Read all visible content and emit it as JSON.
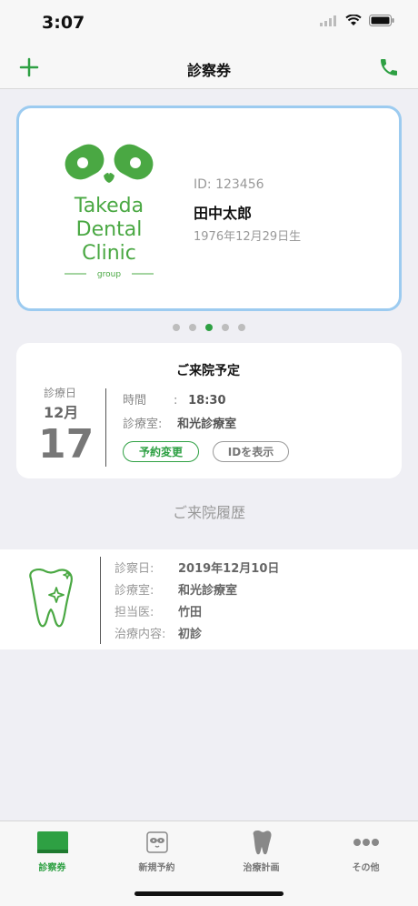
{
  "status_bar": {
    "time": "3:07"
  },
  "nav": {
    "title": "診察券"
  },
  "card": {
    "logo": {
      "line1": "Takeda",
      "line2": "Dental",
      "line3": "Clinic",
      "line4": "group"
    },
    "id": "ID: 123456",
    "name": "田中太郎",
    "dob": "1976年12月29日生"
  },
  "pager": {
    "count": 5,
    "active_index": 2
  },
  "appointment": {
    "title": "ご来院予定",
    "date_label": "診療日",
    "month": "12月",
    "day": "17",
    "time_label": "時間",
    "time_sep": ":",
    "time_value": "18:30",
    "room_label": "診療室:",
    "room_value": "和光診療室",
    "change_button": "予約変更",
    "show_id_button": "IDを表示"
  },
  "history": {
    "title": "ご来院履歴",
    "items": [
      {
        "date_label": "診察日:",
        "date_value": "2019年12月10日",
        "room_label": "診療室:",
        "room_value": "和光診療室",
        "doctor_label": "担当医:",
        "doctor_value": "竹田",
        "treatment_label": "治療内容:",
        "treatment_value": "初診"
      }
    ]
  },
  "tabs": [
    {
      "label": "診察券",
      "icon": "card-icon",
      "active": true
    },
    {
      "label": "新規予約",
      "icon": "panda-icon",
      "active": false
    },
    {
      "label": "治療計画",
      "icon": "tooth-icon",
      "active": false
    },
    {
      "label": "その他",
      "icon": "more-icon",
      "active": false
    }
  ],
  "colors": {
    "accent": "#2ea043",
    "card_border": "#9ccbf0"
  }
}
